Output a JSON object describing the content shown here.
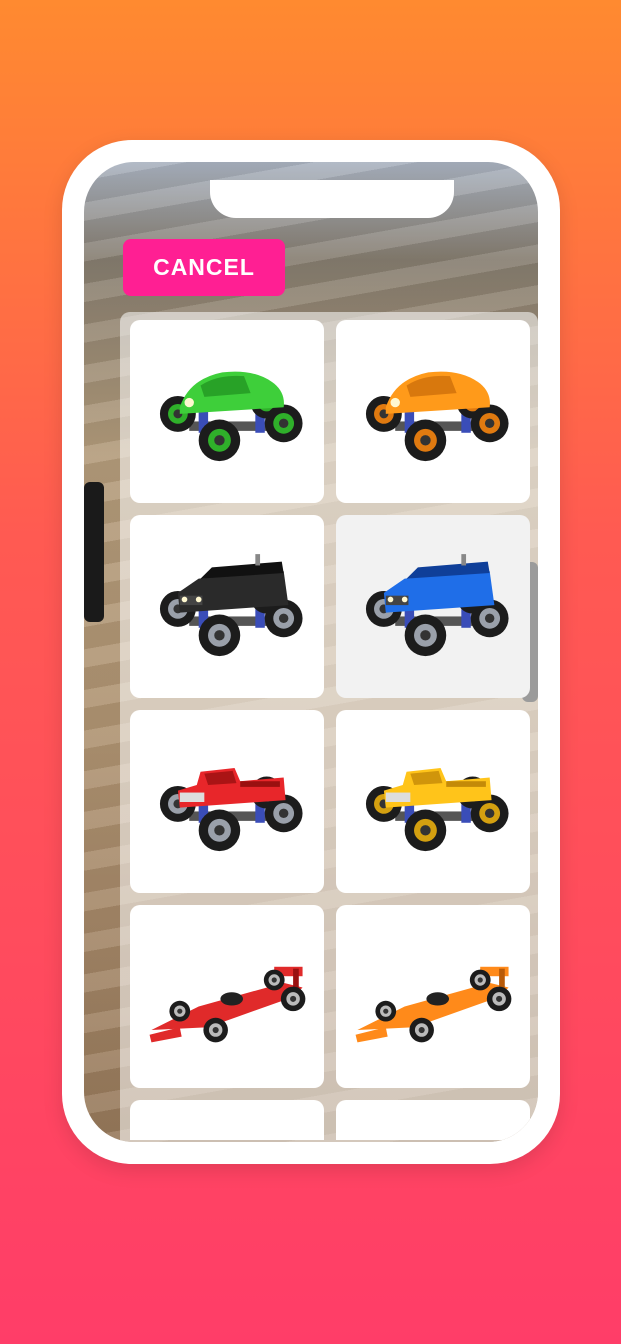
{
  "cancel_button": {
    "label": "CANCEL"
  },
  "vehicles": [
    {
      "kind": "beetle-truck",
      "icon": "green-monster-beetle-icon",
      "body": "#3ecf3a",
      "dark": "#1f8f1f",
      "rim": "#2fb02a"
    },
    {
      "kind": "beetle-truck",
      "icon": "orange-monster-beetle-icon",
      "body": "#ff9a1a",
      "dark": "#c76a08",
      "rim": "#e07a10"
    },
    {
      "kind": "suv-truck",
      "icon": "black-monster-suv-icon",
      "body": "#2a2a2a",
      "dark": "#111111",
      "rim": "#9aa0aa"
    },
    {
      "kind": "suv-truck",
      "icon": "blue-monster-suv-icon",
      "body": "#1f6ee8",
      "dark": "#0f3f99",
      "rim": "#9aa0aa",
      "selected": true
    },
    {
      "kind": "pickup-truck",
      "icon": "red-monster-pickup-icon",
      "body": "#e8262a",
      "dark": "#9a1010",
      "rim": "#9aa0aa"
    },
    {
      "kind": "pickup-truck",
      "icon": "yellow-monster-pickup-icon",
      "body": "#ffc41a",
      "dark": "#c48a08",
      "rim": "#d4a010"
    },
    {
      "kind": "f1-car",
      "icon": "red-f1-car-icon",
      "body": "#e02a2a",
      "dark": "#991010",
      "rim": "#bbbbbb"
    },
    {
      "kind": "f1-car",
      "icon": "orange-f1-car-icon",
      "body": "#ff8a1a",
      "dark": "#b85a08",
      "rim": "#bbbbbb"
    }
  ]
}
